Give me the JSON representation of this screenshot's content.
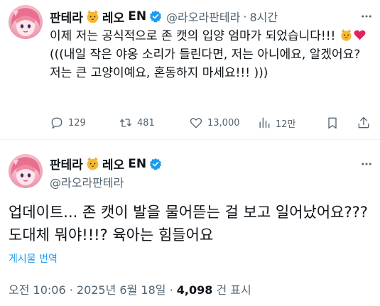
{
  "tweet1": {
    "display_name_part1": "판테라",
    "display_name_part2": "레오",
    "display_name_suffix": "EN",
    "handle": "@라오라판테라",
    "separator": "·",
    "time": "8시간",
    "text_part1": "이제 저는 공식적으로 존 캣의 입양 엄마가 되었습니다!!! ",
    "text_part2": "(((내일 작은 야옹 소리가 들린다면, 저는 아니에요, 알겠어요? 저는 큰 고양이예요, 혼동하지 마세요!!! )))",
    "icons": {
      "name_emoji": "cat-face-icon",
      "verified": "verified-badge-icon",
      "more": "more-icon",
      "text_emoji_1": "cat-face-icon",
      "text_emoji_2": "heart-icon"
    },
    "actions": {
      "reply_count": "129",
      "retweet_count": "481",
      "like_count": "13,000",
      "view_count": "12만"
    }
  },
  "tweet2": {
    "display_name_part1": "판테라",
    "display_name_part2": "레오",
    "display_name_suffix": "EN",
    "handle": "@라오라판테라",
    "text": "업데이트... 존 캣이 발을 물어뜯는 걸 보고 일어났어요??? 도대체 뭐야!!!? 육아는 힘들어요",
    "translate_label": "게시물 번역",
    "meta_time": "오전 10:06 · 2025년 6월 18일 · ",
    "meta_views_count": "4,098",
    "meta_views_label": " 건 표시"
  },
  "colors": {
    "text": "#0f1419",
    "secondary": "#536471",
    "link": "#1d9bf0",
    "verified": "#1d9bf0",
    "heart": "#e0245e",
    "avatar_hair": "#e77a98"
  }
}
